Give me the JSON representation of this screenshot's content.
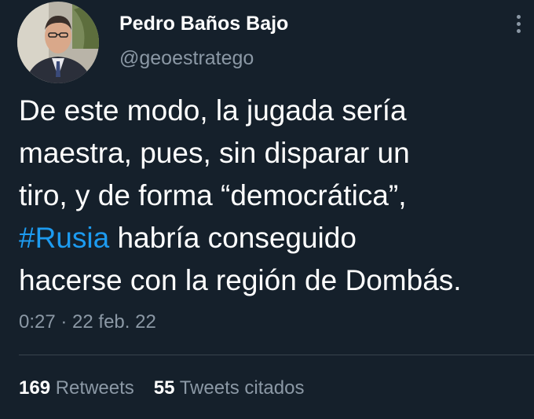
{
  "author": {
    "name": "Pedro Baños Bajo",
    "handle": "@geoestratego"
  },
  "tweet": {
    "lines": [
      "De este modo, la jugada sería",
      "maestra, pues, sin disparar un",
      "tiro, y de forma “democrática”,"
    ],
    "hashtag": "#Rusia",
    "line4_rest": " habría conseguido",
    "line5": "hacerse con la región de Dombás."
  },
  "timestamp": "0:27 · 22 feb. 22",
  "stats": {
    "retweets_count": "169",
    "retweets_label": "Retweets",
    "quotes_count": "55",
    "quotes_label": "Tweets citados"
  },
  "colors": {
    "background": "#15202b",
    "text_primary": "#ffffff",
    "text_secondary": "#8b98a5",
    "link": "#1d9bf0",
    "divider": "#38444d"
  },
  "icons": {
    "more": "more-options-icon",
    "avatar": "profile-photo"
  }
}
